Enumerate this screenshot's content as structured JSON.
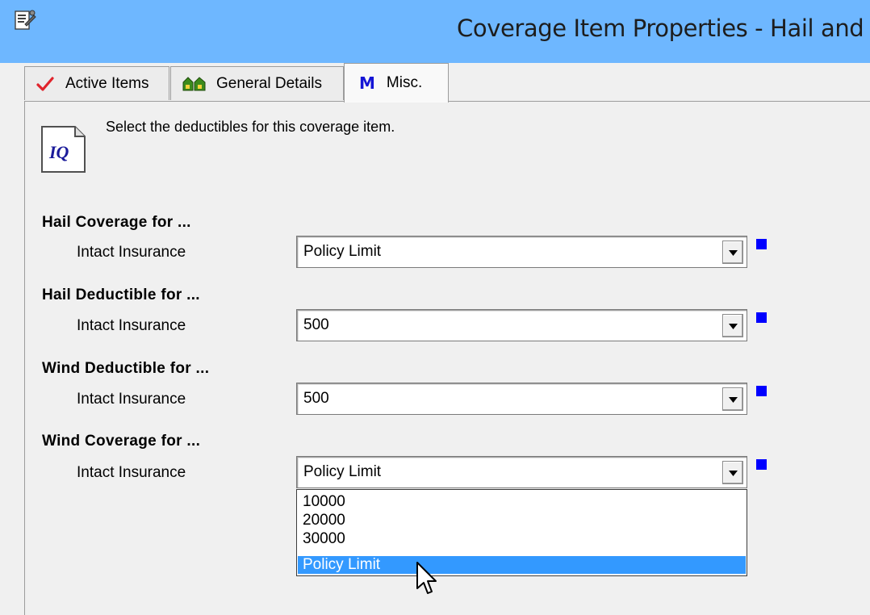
{
  "window": {
    "title": "Coverage Item Properties - Hail and Wi"
  },
  "tabs": [
    {
      "label": "Active Items",
      "icon": "checkmark-icon",
      "active": false
    },
    {
      "label": "General Details",
      "icon": "houses-icon",
      "active": false
    },
    {
      "label": "Misc.",
      "icon": "m-letter-icon",
      "active": true
    }
  ],
  "tab_icon_letters": {
    "misc": "M"
  },
  "intro": {
    "icon_text": "IQ",
    "text": "Select the deductibles for this coverage item."
  },
  "sections": [
    {
      "title": "Hail Coverage for ...",
      "label": "Intact Insurance",
      "value": "Policy Limit"
    },
    {
      "title": "Hail Deductible for ...",
      "label": "Intact Insurance",
      "value": "500"
    },
    {
      "title": "Wind Deductible for ...",
      "label": "Intact Insurance",
      "value": "500"
    },
    {
      "title": "Wind Coverage for ...",
      "label": "Intact Insurance",
      "value": "Policy Limit"
    }
  ],
  "dropdown": {
    "options": [
      "10000",
      "20000",
      "30000",
      "Policy Limit"
    ],
    "selected": "Policy Limit"
  },
  "colors": {
    "titlebar": "#6eb7ff",
    "marker": "#0000ff",
    "selection": "#3399ff",
    "checkmark": "#e0242c",
    "misc_letter": "#1515d6"
  }
}
